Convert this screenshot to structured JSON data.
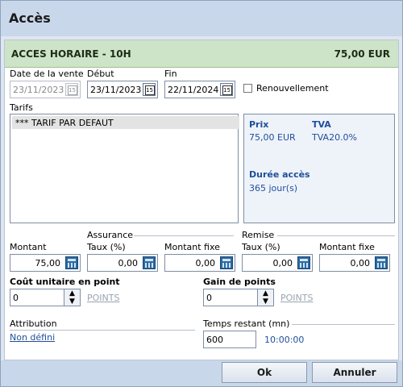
{
  "window": {
    "title": "Accès"
  },
  "banner": {
    "name": "ACCES HORAIRE - 10H",
    "price": "75,00 EUR"
  },
  "dates": {
    "sale_label": "Date de la vente",
    "sale_value": "23/11/2023",
    "start_label": "Début",
    "start_value": "23/11/2023",
    "end_label": "Fin",
    "end_value": "22/11/2024",
    "renew_label": "Renouvellement"
  },
  "tarifs": {
    "label": "Tarifs",
    "items": [
      "*** TARIF PAR DEFAUT"
    ]
  },
  "info": {
    "prix_label": "Prix",
    "prix_value": "75,00 EUR",
    "tva_label": "TVA",
    "tva_value": "TVA20.0%",
    "duree_label": "Durée accès",
    "duree_value": "365 jour(s)"
  },
  "amounts": {
    "assurance_group": "Assurance",
    "remise_group": "Remise",
    "montant_label": "Montant",
    "montant_value": "75,00",
    "ass_taux_label": "Taux (%)",
    "ass_taux_value": "0,00",
    "ass_fixe_label": "Montant fixe",
    "ass_fixe_value": "0,00",
    "rem_taux_label": "Taux (%)",
    "rem_taux_value": "0,00",
    "rem_fixe_label": "Montant fixe",
    "rem_fixe_value": "0,00"
  },
  "points": {
    "cout_label": "Coût unitaire en point",
    "cout_value": "0",
    "cout_unit": "POINTS",
    "gain_label": "Gain de points",
    "gain_value": "0",
    "gain_unit": "POINTS"
  },
  "attribution": {
    "label": "Attribution",
    "value": "Non défini"
  },
  "temps": {
    "label": "Temps restant (mn)",
    "value": "600",
    "display": "10:00:00"
  },
  "buttons": {
    "ok": "Ok",
    "cancel": "Annuler"
  },
  "colors": {
    "banner_bg": "#cde4c8",
    "link_blue": "#1f4e9a",
    "titlebar": "#c9d7ea"
  }
}
